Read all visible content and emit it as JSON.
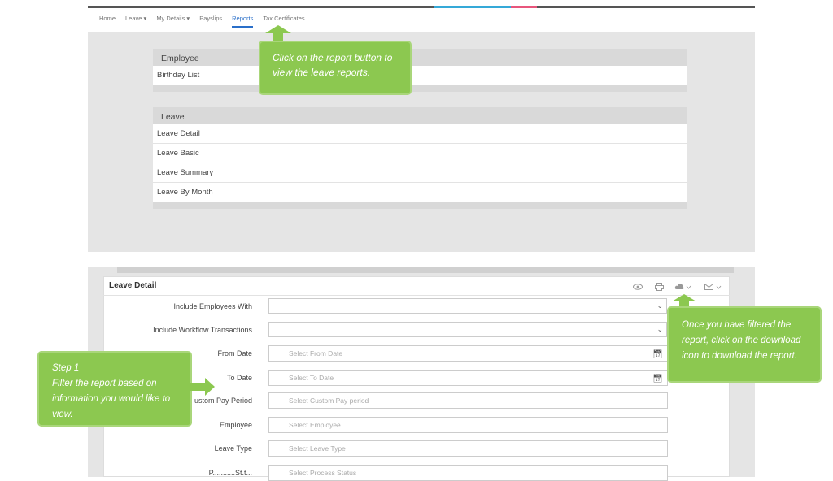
{
  "nav": {
    "items": [
      {
        "label": "Home"
      },
      {
        "label": "Leave",
        "caret": "▾"
      },
      {
        "label": "My Details",
        "caret": "▾"
      },
      {
        "label": "Payslips"
      },
      {
        "label": "Reports"
      },
      {
        "label": "Tax Certificates"
      }
    ]
  },
  "reports": {
    "employee_header": "Employee",
    "employee_items": [
      "Birthday List"
    ],
    "leave_header": "Leave",
    "leave_items": [
      "Leave Detail",
      "Leave Basic",
      "Leave Summary",
      "Leave By Month"
    ]
  },
  "callouts": {
    "report": "Click on the report button to view the leave reports.",
    "download": "Once you have filtered the report, click on the download icon to download the report.",
    "step_title": "Step 1",
    "step_text": "Filter the report based on information you would like to view."
  },
  "form": {
    "title": "Leave Detail",
    "fields": {
      "include_employees": {
        "label": "Include Employees With"
      },
      "include_workflow": {
        "label": "Include Workflow Transactions"
      },
      "from_date": {
        "label": "From Date",
        "placeholder": "Select From Date"
      },
      "to_date": {
        "label": "To Date",
        "placeholder": "Select To Date"
      },
      "custom_pay_period": {
        "label": "Custom Pay Period",
        "visible_label": "ustom Pay Period",
        "placeholder": "Select Custom Pay period"
      },
      "employee": {
        "label": "Employee",
        "placeholder": "Select Employee"
      },
      "leave_type": {
        "label": "Leave Type",
        "placeholder": "Select Leave Type"
      },
      "process_status": {
        "visible_label": "P...........St.t...",
        "placeholder": "Select Process Status"
      }
    },
    "toolbar": {
      "view_icon": "eye-icon",
      "print_icon": "printer-icon",
      "download_icon": "cloud-download-icon",
      "email_icon": "mail-icon"
    }
  },
  "colors": {
    "callout_green": "#8cc850",
    "active_tab": "#2a6fc9"
  }
}
